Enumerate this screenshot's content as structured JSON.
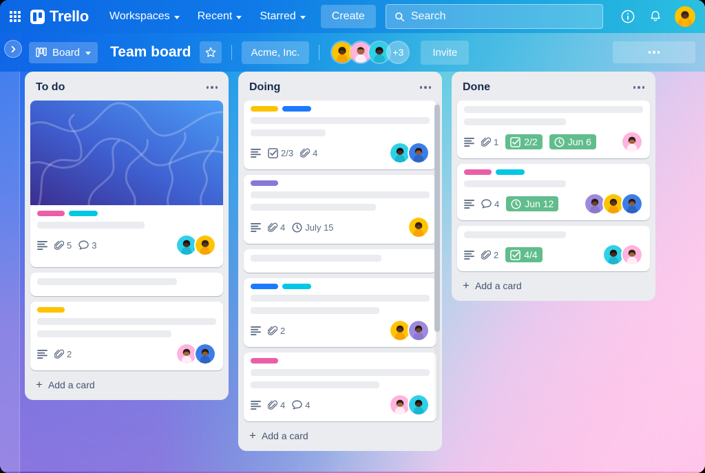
{
  "topnav": {
    "apps_icon": "app-switcher-grid-icon",
    "logo_text": "Trello",
    "items": [
      {
        "label": "Workspaces",
        "caret": true
      },
      {
        "label": "Recent",
        "caret": true
      },
      {
        "label": "Starred",
        "caret": true
      }
    ],
    "create_label": "Create",
    "search": {
      "placeholder": "Search",
      "value": "",
      "icon": "search-icon"
    },
    "info_icon": "info-circle-icon",
    "notifications_icon": "bell-icon",
    "avatar": "user-avatar"
  },
  "boardbar": {
    "sidebar_toggle_icon": "chevron-right-icon",
    "view_label": "Board",
    "board_title": "Team board",
    "star_icon": "star-icon",
    "workspace_label": "Acme, Inc.",
    "members_overflow": "+3",
    "invite_label": "Invite",
    "menu_icon": "ellipsis-icon"
  },
  "colors": {
    "nav_blue": "#0c66e4",
    "nav_cyan": "#2bbfe0",
    "list_bg": "#ebecf0",
    "card_bg": "#ffffff",
    "text_dark": "#172b4d",
    "text_muted": "#5e6c84",
    "green_badge": "#61bd8c",
    "label_pink": "#e95fa8",
    "label_cyan": "#00c7e5",
    "label_yellow": "#fdc300",
    "label_blue": "#1d7afc",
    "label_purple": "#8777d9"
  },
  "lists": [
    {
      "title": "To do",
      "menu_icon": "ellipsis-icon",
      "add_card_label": "Add a card",
      "cards": [
        {
          "cover": "blue-gradient-abstract-cover",
          "labels": [
            "#e95fa8",
            "#00c7e5"
          ],
          "placeholders": [
            60
          ],
          "badges": [
            {
              "type": "description",
              "icon": "description-icon"
            },
            {
              "type": "attachment",
              "icon": "attachment-icon",
              "value": "5"
            },
            {
              "type": "comment",
              "icon": "comment-icon",
              "value": "3"
            }
          ],
          "avatars": [
            "cyan-avatar",
            "yellow-avatar"
          ]
        },
        {
          "labels": [],
          "placeholders": [
            78
          ],
          "badges": [],
          "avatars": []
        },
        {
          "labels": [
            "#fdc300"
          ],
          "placeholders": [
            100,
            75
          ],
          "badges": [
            {
              "type": "description",
              "icon": "description-icon"
            },
            {
              "type": "attachment",
              "icon": "attachment-icon",
              "value": "2"
            }
          ],
          "avatars": [
            "pink-avatar",
            "blue-avatar"
          ]
        }
      ]
    },
    {
      "title": "Doing",
      "menu_icon": "ellipsis-icon",
      "add_card_label": "Add a card",
      "has_scrollbar": true,
      "cards": [
        {
          "labels": [
            "#fdc300",
            "#1d7afc"
          ],
          "placeholders": [
            100,
            42
          ],
          "badges": [
            {
              "type": "description",
              "icon": "description-icon"
            },
            {
              "type": "checklist",
              "icon": "checklist-icon",
              "value": "2/3"
            },
            {
              "type": "attachment",
              "icon": "attachment-icon",
              "value": "4"
            }
          ],
          "avatars": [
            "cyan-avatar",
            "blue-avatar"
          ]
        },
        {
          "labels": [
            "#8777d9"
          ],
          "placeholders": [
            100,
            70
          ],
          "badges": [
            {
              "type": "description",
              "icon": "description-icon"
            },
            {
              "type": "attachment",
              "icon": "attachment-icon",
              "value": "4"
            },
            {
              "type": "due",
              "icon": "clock-icon",
              "value": "July 15"
            }
          ],
          "avatars": [
            "yellow-avatar"
          ]
        },
        {
          "labels": [],
          "placeholders": [
            73
          ],
          "badges": [],
          "avatars": []
        },
        {
          "labels": [
            "#1d7afc",
            "#00c7e5"
          ],
          "placeholders": [
            100,
            72
          ],
          "badges": [
            {
              "type": "description",
              "icon": "description-icon"
            },
            {
              "type": "attachment",
              "icon": "attachment-icon",
              "value": "2"
            }
          ],
          "avatars": [
            "yellow-avatar",
            "purple-avatar"
          ]
        },
        {
          "labels": [
            "#e95fa8"
          ],
          "placeholders": [
            100,
            72
          ],
          "badges": [
            {
              "type": "description",
              "icon": "description-icon"
            },
            {
              "type": "attachment",
              "icon": "attachment-icon",
              "value": "4"
            },
            {
              "type": "comment",
              "icon": "comment-icon",
              "value": "4"
            }
          ],
          "avatars": [
            "pink-avatar",
            "cyan-avatar"
          ]
        }
      ]
    },
    {
      "title": "Done",
      "menu_icon": "ellipsis-icon",
      "add_card_label": "Add a card",
      "cards": [
        {
          "labels": [],
          "placeholders": [
            100,
            57
          ],
          "badges": [
            {
              "type": "description",
              "icon": "description-icon"
            },
            {
              "type": "attachment",
              "icon": "attachment-icon",
              "value": "1"
            },
            {
              "type": "checklist",
              "icon": "checklist-icon",
              "value": "2/2",
              "green": true
            },
            {
              "type": "due",
              "icon": "clock-icon",
              "value": "Jun 6",
              "green": true
            }
          ],
          "avatars": [
            "pink-avatar"
          ]
        },
        {
          "labels": [
            "#e95fa8",
            "#00c7e5"
          ],
          "placeholders": [
            57
          ],
          "badges": [
            {
              "type": "description",
              "icon": "description-icon"
            },
            {
              "type": "comment",
              "icon": "comment-icon",
              "value": "4"
            },
            {
              "type": "due",
              "icon": "clock-icon",
              "value": "Jun 12",
              "green": true
            }
          ],
          "avatars": [
            "purple-avatar",
            "yellow-avatar",
            "blue-avatar"
          ]
        },
        {
          "labels": [],
          "placeholders": [
            57
          ],
          "badges": [
            {
              "type": "description",
              "icon": "description-icon"
            },
            {
              "type": "attachment",
              "icon": "attachment-icon",
              "value": "2"
            },
            {
              "type": "checklist",
              "icon": "checklist-icon",
              "value": "4/4",
              "green": true
            }
          ],
          "avatars": [
            "cyan-avatar",
            "pink-avatar"
          ]
        }
      ]
    }
  ]
}
